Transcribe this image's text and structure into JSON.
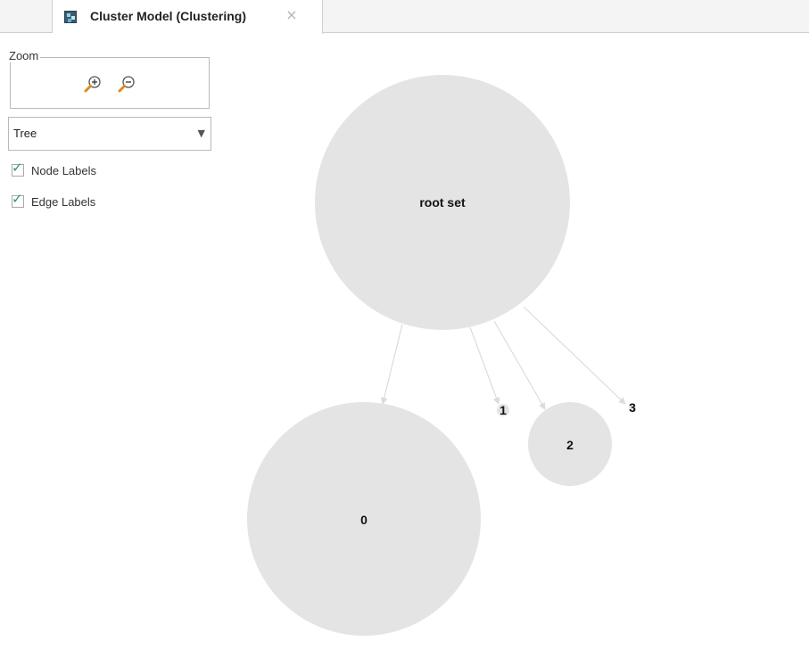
{
  "tab": {
    "title": "Cluster Model (Clustering)",
    "close_glyph": "×",
    "icon": "cluster-model-icon"
  },
  "zoom": {
    "legend": "Zoom",
    "zoom_in_icon": "zoom-in-icon",
    "zoom_out_icon": "zoom-out-icon"
  },
  "layout_select": {
    "value": "Tree",
    "arrow_glyph": "▼"
  },
  "options": {
    "node_labels": {
      "label": "Node Labels",
      "checked": true
    },
    "edge_labels": {
      "label": "Edge Labels",
      "checked": true
    }
  },
  "graph": {
    "nodes": {
      "root": "root set",
      "c0": "0",
      "c1": "1",
      "c2": "2",
      "c3": "3"
    },
    "colors": {
      "node_fill": "#e4e4e4",
      "edge": "#dcdcdc",
      "check": "#2f9a5a"
    }
  }
}
